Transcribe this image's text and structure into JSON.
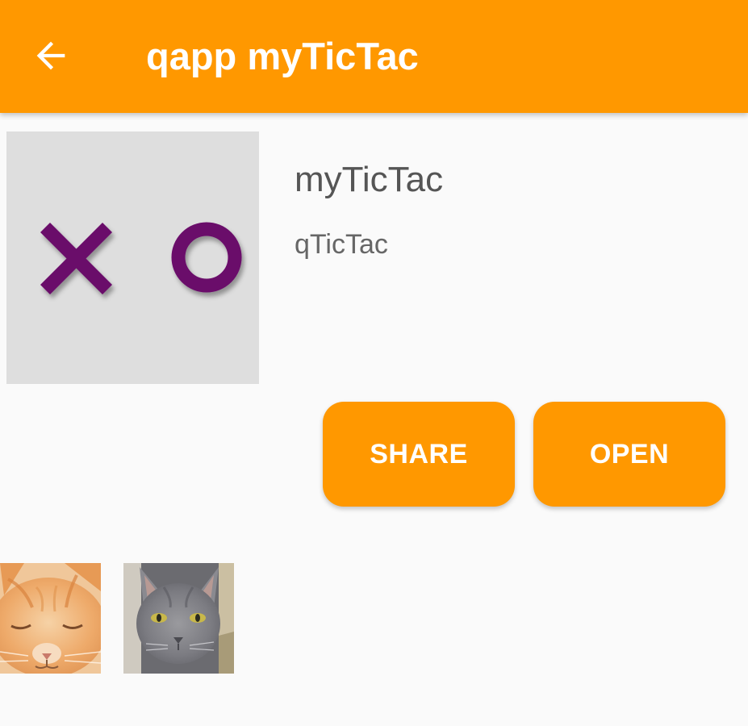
{
  "appbar": {
    "title": "qapp myTicTac",
    "back_icon": "arrow-back-icon",
    "background": "#ff9800"
  },
  "app": {
    "name": "myTicTac",
    "subtitle": "qTicTac",
    "icon": "tic-tac-toe-x-o-icon",
    "icon_symbol_color": "#6b0a6b"
  },
  "actions": {
    "share_label": "SHARE",
    "open_label": "OPEN"
  },
  "screenshots": [
    {
      "subject": "orange-tabby-kitten-photo"
    },
    {
      "subject": "gray-cat-photo"
    }
  ]
}
